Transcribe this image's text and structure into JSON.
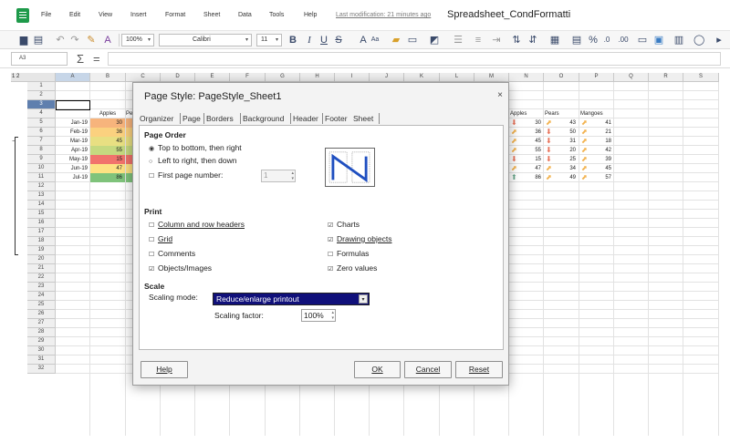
{
  "menubar": {
    "items": [
      "File",
      "Edit",
      "View",
      "Insert",
      "Format",
      "Sheet",
      "Data",
      "Tools",
      "Help"
    ],
    "last_modification": "Last modification: 21 minutes ago",
    "doc_title": "Spreadsheet_CondFormatti"
  },
  "toolbar": {
    "zoom": "100%",
    "font_name": "Calibri",
    "font_size": "11"
  },
  "formulabar": {
    "cell_ref": "A3",
    "sum_symbol": "Σ",
    "equals_symbol": "="
  },
  "grid": {
    "corner": "1 2",
    "columns": [
      "A",
      "B",
      "C",
      "D",
      "E",
      "F",
      "G",
      "H",
      "I",
      "J",
      "K",
      "L",
      "M",
      "N",
      "O",
      "P",
      "Q",
      "R",
      "S"
    ],
    "rows": [
      "1",
      "2",
      "3",
      "4",
      "5",
      "6",
      "7",
      "8",
      "9",
      "10",
      "11",
      "12",
      "13",
      "14",
      "15",
      "16",
      "17",
      "18",
      "19",
      "20",
      "21",
      "22",
      "23",
      "24",
      "25",
      "26",
      "27",
      "28",
      "29",
      "30",
      "31",
      "32"
    ],
    "selected_column": "A",
    "selected_row": "3",
    "header_apples": "Apples",
    "header_apples_partial": "Pe",
    "months": [
      "Jan-19",
      "Feb-19",
      "Mar-19",
      "Apr-19",
      "May-19",
      "Jun-19",
      "Jul-19"
    ],
    "apples": [
      "30",
      "36",
      "45",
      "55",
      "15",
      "47",
      "86"
    ],
    "apples_colors": [
      "#f7b47c",
      "#fbd17f",
      "#e8df82",
      "#c5d980",
      "#f1736c",
      "#fde283",
      "#7fc37b"
    ],
    "right_headers": [
      "Apples",
      "Pears",
      "Mangoes"
    ],
    "right_apples": [
      "30",
      "36",
      "45",
      "55",
      "15",
      "47",
      "86"
    ],
    "right_pears": [
      "43",
      "50",
      "31",
      "20",
      "25",
      "34",
      "49"
    ],
    "right_mangoes": [
      "41",
      "21",
      "18",
      "42",
      "39",
      "45",
      "57"
    ],
    "apples_arrows": [
      "down",
      "diag",
      "diag",
      "diag",
      "down",
      "diag",
      "up"
    ],
    "pears_arrows": [
      "diag",
      "down",
      "down",
      "down",
      "down",
      "diag",
      "diag"
    ],
    "mangoes_arrows": [
      "diag",
      "diag",
      "diag",
      "diag",
      "diag",
      "diag",
      "diag"
    ],
    "arrow_colors": {
      "down": "#e8735a",
      "diag": "#f2b24e",
      "up": "#6aa88c"
    }
  },
  "dialog": {
    "title": "Page Style: PageStyle_Sheet1",
    "close": "×",
    "tabs": [
      "Organizer",
      "Page",
      "Borders",
      "Background",
      "Header",
      "Footer",
      "Sheet"
    ],
    "page_order_title": "Page Order",
    "top_to_bottom": "Top to bottom, then right",
    "left_to_right": "Left to right, then down",
    "first_page_number": "First page number:",
    "first_page_value": "1",
    "print_title": "Print",
    "column_row_headers": "Column and row headers",
    "grid": "Grid",
    "comments": "Comments",
    "objects_images": "Objects/Images",
    "charts": "Charts",
    "drawing_objects": "Drawing objects",
    "formulas": "Formulas",
    "zero_values": "Zero values",
    "scale_title": "Scale",
    "scaling_mode_label": "Scaling mode:",
    "scaling_mode_value": "Reduce/enlarge printout",
    "scaling_factor_label": "Scaling factor:",
    "scaling_factor_value": "100%",
    "buttons": {
      "help": "Help",
      "ok": "OK",
      "cancel": "Cancel",
      "reset": "Reset"
    }
  }
}
